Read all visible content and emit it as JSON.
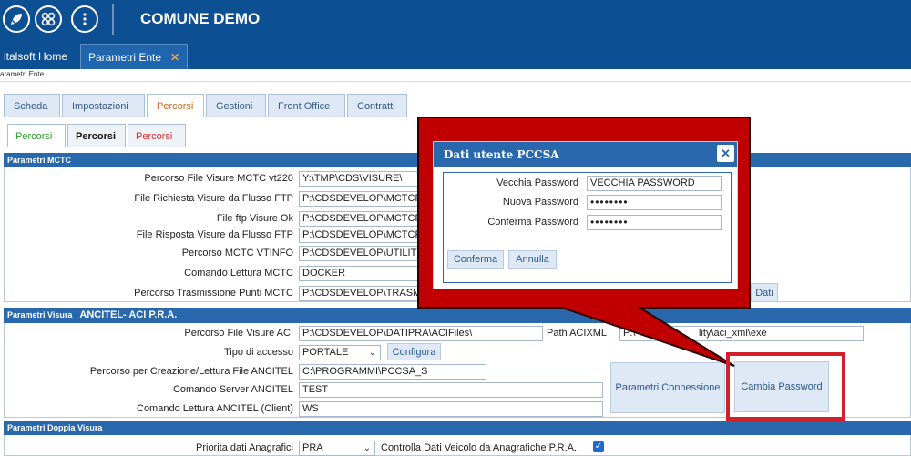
{
  "header": {
    "app_title": "COMUNE DEMO",
    "icons": [
      "rocket-icon",
      "apps-grid-icon",
      "more-vertical-icon"
    ]
  },
  "main_tabs": [
    {
      "label": "italsoft Home",
      "active": false
    },
    {
      "label": "Parametri Ente",
      "active": true,
      "close": "✕"
    }
  ],
  "breadcrumb": "arametri Ente",
  "section_tabs": [
    "Scheda",
    "Impostazioni",
    "Percorsi",
    "Gestioni",
    "Front Office",
    "Contratti"
  ],
  "sub_tabs": [
    "Percorsi",
    "Percorsi",
    "Percorsi"
  ],
  "mctc": {
    "header": "Parametri MCTC",
    "rows": [
      {
        "label": "Percorso File Visure MCTC vt220",
        "value": "Y:\\TMP\\CDS\\VISURE\\"
      },
      {
        "label": "File Richiesta Visure da Flusso FTP",
        "value": "P:\\CDSDEVELOP\\MCTCFT"
      },
      {
        "label": "File ftp Visure Ok",
        "value": "P:\\CDSDEVELOP\\MCTCFT"
      },
      {
        "label": "File Risposta Visure da Flusso FTP",
        "value": "P:\\CDSDEVELOP\\MCTCFT"
      },
      {
        "label": "Percorso MCTC VTINFO",
        "value": "P:\\CDSDEVELOP\\UTILITY\\"
      },
      {
        "label": "Comando Lettura MCTC",
        "value": "DOCKER"
      },
      {
        "label": "Percorso Trasmissione Punti MCTC",
        "value": "P:\\CDSDEVELOP\\TRASMC"
      }
    ],
    "dati_button": "Dati"
  },
  "visura": {
    "header_small": "Parametri Visura",
    "header_big": "ANCITEL- ACI P.R.A.",
    "percorso_label": "Percorso File Visure ACI",
    "percorso_value": "P:\\CDSDEVELOP\\DATIPRA\\ACIFiles\\",
    "path_acixml_label": "Path ACIXML",
    "path_acixml_value_left": "P:\\",
    "path_acixml_value_right": "lity\\aci_xml\\exe",
    "tipo_label": "Tipo di accesso",
    "tipo_value": "PORTALE",
    "configura_label": "Configura",
    "creazione_label": "Percorso per Creazione/Lettura File ANCITEL",
    "creazione_value": "C:\\PROGRAMMI\\PCCSA_S",
    "server_label": "Comando Server ANCITEL",
    "server_value": "TEST",
    "client_label": "Comando Lettura ANCITEL (Client)",
    "client_value": "WS",
    "parametri_connessione_label": "Parametri Connessione",
    "cambia_password_label": "Cambia Password"
  },
  "doppia": {
    "header": "Parametri Doppia Visura",
    "priorita_label": "Priorita dati Anagrafici",
    "priorita_value": "PRA",
    "controlla_label": "Controlla Dati Veicolo da Anagrafiche P.R.A.",
    "controlla_checked": true
  },
  "dialog": {
    "title": "Dati utente PCCSA",
    "close": "✕",
    "vecchia_label": "Vecchia Password",
    "vecchia_value": "VECCHIA PASSWORD",
    "nuova_label": "Nuova Password",
    "nuova_value": "••••••••",
    "conferma_label": "Conferma Password",
    "conferma_value": "••••••••",
    "conferma_button": "Conferma",
    "annulla_button": "Annulla"
  },
  "colors": {
    "header_blue": "#0d4f93",
    "group_blue": "#2968ad",
    "callout_red": "#c00000",
    "active_tab_orange": "#d0641c"
  }
}
